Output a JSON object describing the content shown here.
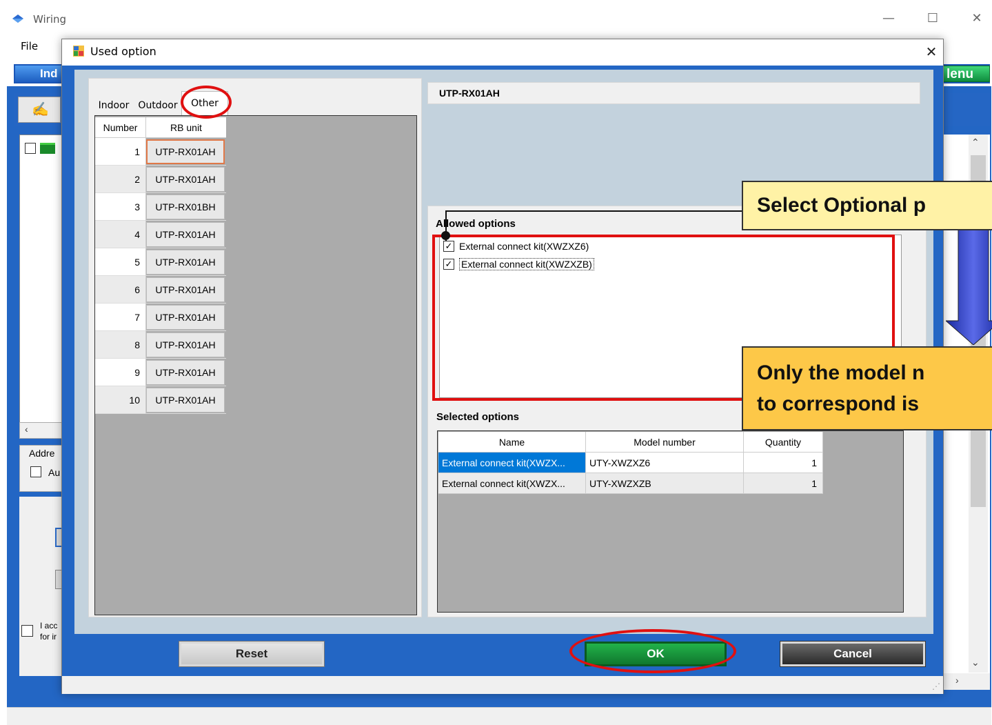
{
  "main_window": {
    "title": "Wiring",
    "menu_file": "File",
    "ind_button": "Ind",
    "menu_button": "lenu",
    "address_label": "Addre",
    "address_check_label": "Au",
    "accept_text_1": "I acc",
    "accept_text_2": "for ir",
    "win_minimize": "—",
    "win_maximize": "☐",
    "win_close": "✕"
  },
  "dialog": {
    "title": "Used option",
    "close": "✕",
    "tabs": [
      {
        "label": "Indoor",
        "active": false
      },
      {
        "label": "Outdoor",
        "active": false
      },
      {
        "label": "Other",
        "active": true
      }
    ],
    "unit_table": {
      "headers": {
        "number": "Number",
        "unit": "RB unit"
      },
      "rows": [
        {
          "number": "1",
          "unit": "UTP-RX01AH",
          "selected": true
        },
        {
          "number": "2",
          "unit": "UTP-RX01AH"
        },
        {
          "number": "3",
          "unit": "UTP-RX01BH"
        },
        {
          "number": "4",
          "unit": "UTP-RX01AH"
        },
        {
          "number": "5",
          "unit": "UTP-RX01AH"
        },
        {
          "number": "6",
          "unit": "UTP-RX01AH"
        },
        {
          "number": "7",
          "unit": "UTP-RX01AH"
        },
        {
          "number": "8",
          "unit": "UTP-RX01AH"
        },
        {
          "number": "9",
          "unit": "UTP-RX01AH"
        },
        {
          "number": "10",
          "unit": "UTP-RX01AH"
        }
      ]
    },
    "selected_model": "UTP-RX01AH",
    "allowed_options": {
      "label": "Allowed options",
      "items": [
        {
          "label": "External connect kit(XWZXZ6)",
          "checked": true
        },
        {
          "label": "External connect kit(XWZXZB)",
          "checked": true
        }
      ]
    },
    "selected_options": {
      "label": "Selected options",
      "headers": {
        "name": "Name",
        "model": "Model number",
        "quantity": "Quantity"
      },
      "rows": [
        {
          "name": "External connect kit(XWZX...",
          "model": "UTY-XWZXZ6",
          "quantity": "1"
        },
        {
          "name": "External connect kit(XWZX...",
          "model": "UTY-XWZXZB",
          "quantity": "1"
        }
      ]
    },
    "buttons": {
      "reset": "Reset",
      "ok": "OK",
      "cancel": "Cancel"
    }
  },
  "annotations": {
    "callout_select": "Select Optional p",
    "callout_only_line1": "Only the model n",
    "callout_only_line2": "to correspond  is"
  },
  "colors": {
    "dialog_blue": "#2366c4",
    "ok_green": "#1a9a3c",
    "annotation_red": "#e01010",
    "callout_yellow": "#fff2a6",
    "callout_orange": "#fdc848",
    "selection_blue": "#0078d7"
  }
}
